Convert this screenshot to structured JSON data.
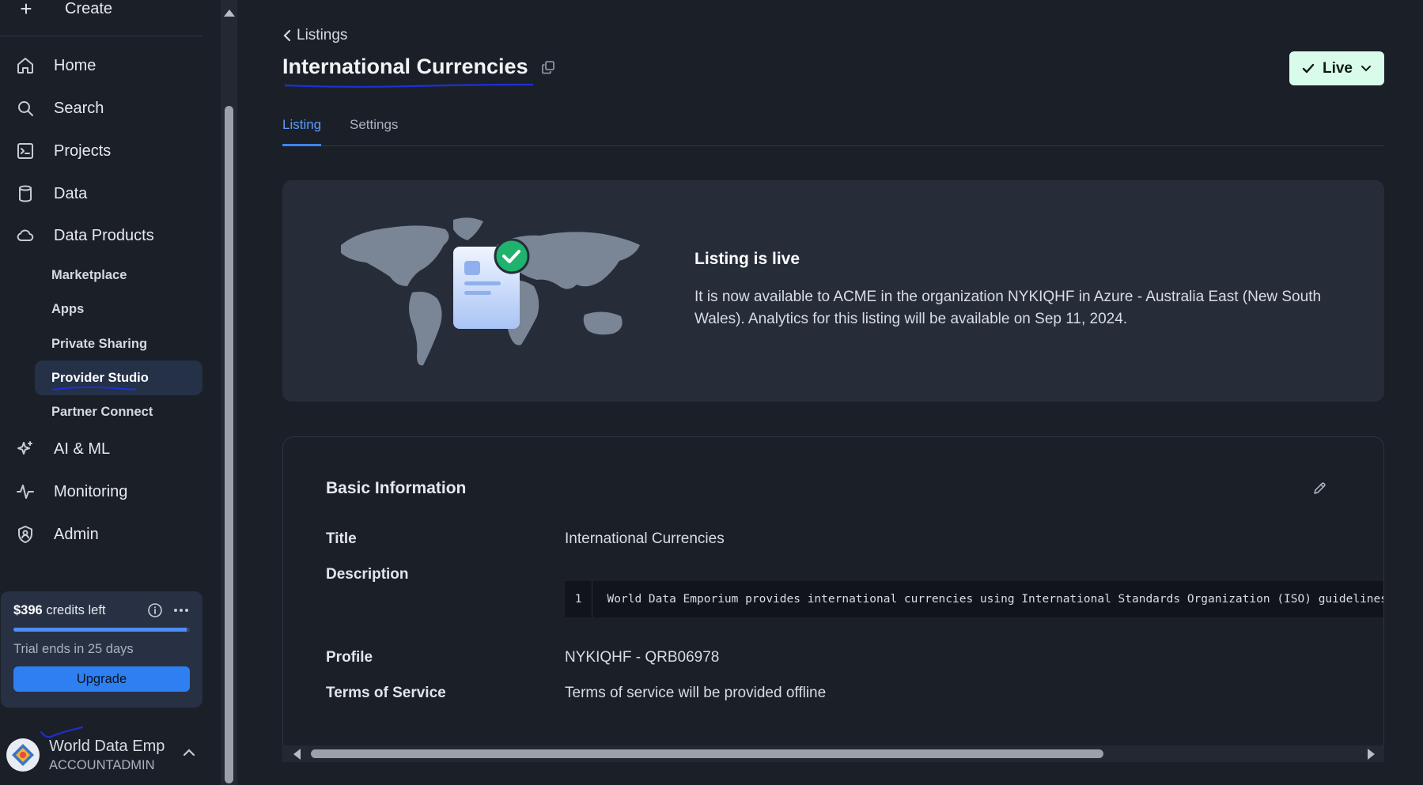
{
  "sidebar": {
    "create_label": "Create",
    "nav": [
      {
        "label": "Home",
        "icon": "home-icon"
      },
      {
        "label": "Search",
        "icon": "search-icon"
      },
      {
        "label": "Projects",
        "icon": "terminal-icon"
      },
      {
        "label": "Data",
        "icon": "database-icon"
      },
      {
        "label": "Data Products",
        "icon": "cloud-icon"
      }
    ],
    "sub_items": [
      "Marketplace",
      "Apps",
      "Private Sharing",
      "Provider Studio",
      "Partner Connect"
    ],
    "nav2": [
      {
        "label": "AI & ML",
        "icon": "sparkle-icon"
      },
      {
        "label": "Monitoring",
        "icon": "activity-icon"
      },
      {
        "label": "Admin",
        "icon": "shield-icon"
      }
    ],
    "credits": {
      "amount": "$396",
      "suffix": "credits left",
      "used_fraction": 0.98,
      "trial": "Trial ends in 25 days",
      "upgrade_label": "Upgrade"
    },
    "user": {
      "name": "World Data Emp",
      "role": "ACCOUNTADMIN"
    }
  },
  "header": {
    "breadcrumb": "Listings",
    "title": "International Currencies",
    "status_label": "Live"
  },
  "tabs": [
    "Listing",
    "Settings"
  ],
  "live_card": {
    "heading": "Listing is live",
    "message": "It is now available to ACME in the organization NYKIQHF in Azure - Australia East (New South Wales). Analytics for this listing will be available on Sep 11, 2024."
  },
  "basic_info": {
    "heading": "Basic Information",
    "title_label": "Title",
    "title_value": "International Currencies",
    "description_label": "Description",
    "description_line_no": "1",
    "description_code": "World Data Emporium provides international currencies using International Standards Organization (ISO) guidelines",
    "profile_label": "Profile",
    "profile_value": "NYKIQHF - QRB06978",
    "tos_label": "Terms of Service",
    "tos_value": "Terms of service will be provided offline"
  },
  "colors": {
    "accent": "#3d85f5",
    "live_bg": "#d9fbe9",
    "success": "#22b573"
  }
}
